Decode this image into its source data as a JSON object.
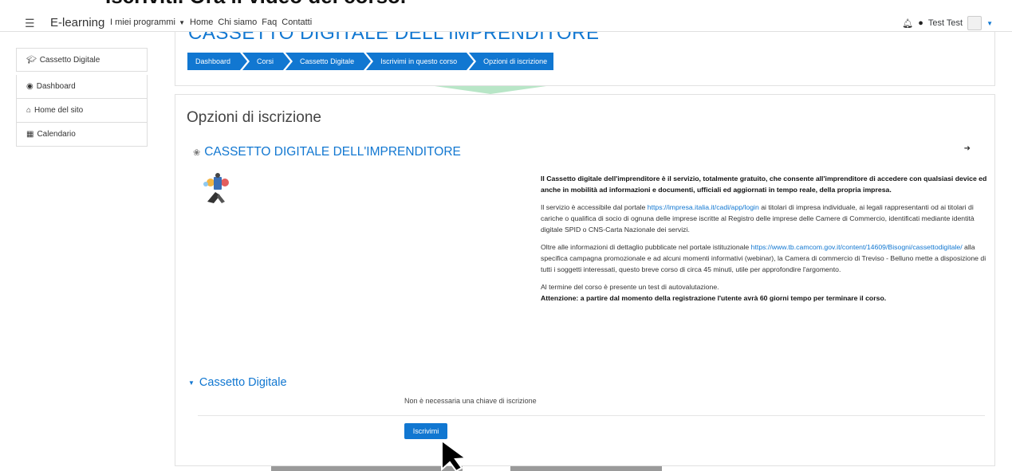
{
  "doc_overlay": {
    "text": "Iscriviti. Ora il video del corso."
  },
  "navbar": {
    "brand": "E-learning",
    "menu": [
      {
        "label": "I miei programmi",
        "has_caret": true
      },
      {
        "label": "Home"
      },
      {
        "label": "Chi siamo"
      },
      {
        "label": "Faq"
      },
      {
        "label": "Contatti"
      }
    ],
    "user_name": "Test Test"
  },
  "sidebar": {
    "items": [
      {
        "label": "Cassetto Digitale",
        "icon": "graduation-cap-icon"
      },
      {
        "label": "Dashboard",
        "icon": "dashboard-icon"
      },
      {
        "label": "Home del sito",
        "icon": "home-icon"
      },
      {
        "label": "Calendario",
        "icon": "calendar-icon"
      }
    ]
  },
  "header": {
    "course_title": "CASSETTO DIGITALE DELL'IMPRENDITORE",
    "breadcrumb": [
      "Dashboard",
      "Corsi",
      "Cassetto Digitale",
      "Iscrivimi in questo corso",
      "Opzioni di iscrizione"
    ]
  },
  "main": {
    "page_heading": "Opzioni di iscrizione",
    "course_title": "CASSETTO DIGITALE DELL'IMPRENDITORE",
    "summary": {
      "p1": "Il Cassetto digitale dell'imprenditore è il servizio, totalmente gratuito, che consente all'imprenditore di accedere con qualsiasi device ed anche in mobilità ad informazioni e documenti, ufficiali ed aggiornati in tempo reale, della propria impresa.",
      "p2_before": "Il servizio è accessibile dal portale ",
      "p2_link": "https://impresa.italia.it/cadi/app/login",
      "p2_after": " ai titolari di impresa individuale, ai legali rappresentanti od ai titolari di cariche o qualifica di socio di ognuna delle imprese iscritte al Registro delle imprese delle Camere di Commercio, identificati mediante identità digitale SPID  o CNS-Carta Nazionale dei servizi.",
      "p3_before": "Oltre alle informazioni di dettaglio pubblicate nel portale istituzionale ",
      "p3_link": "https://www.tb.camcom.gov.it/content/14609/Bisogni/cassettodigitale/",
      "p3_after": " alla specifica campagna promozionale e ad alcuni momenti informativi (webinar), la Camera di commercio di Treviso - Belluno mette a disposizione di tutti i soggetti interessati, questo breve corso di circa 45 minuti, utile per approfondire l'argomento.",
      "p4": "Al termine del corso è presente un test di autovalutazione.",
      "p5": "Attenzione: a partire dal momento della registrazione l'utente avrà 60 giorni tempo per terminare il corso."
    },
    "section_title": "Cassetto Digitale",
    "no_key_text": "Non è necessaria una chiave di iscrizione",
    "enrol_button": "Iscrivimi"
  },
  "colors": {
    "primary": "#1177d1",
    "border": "#e1e1e1",
    "text": "#373a3c"
  }
}
